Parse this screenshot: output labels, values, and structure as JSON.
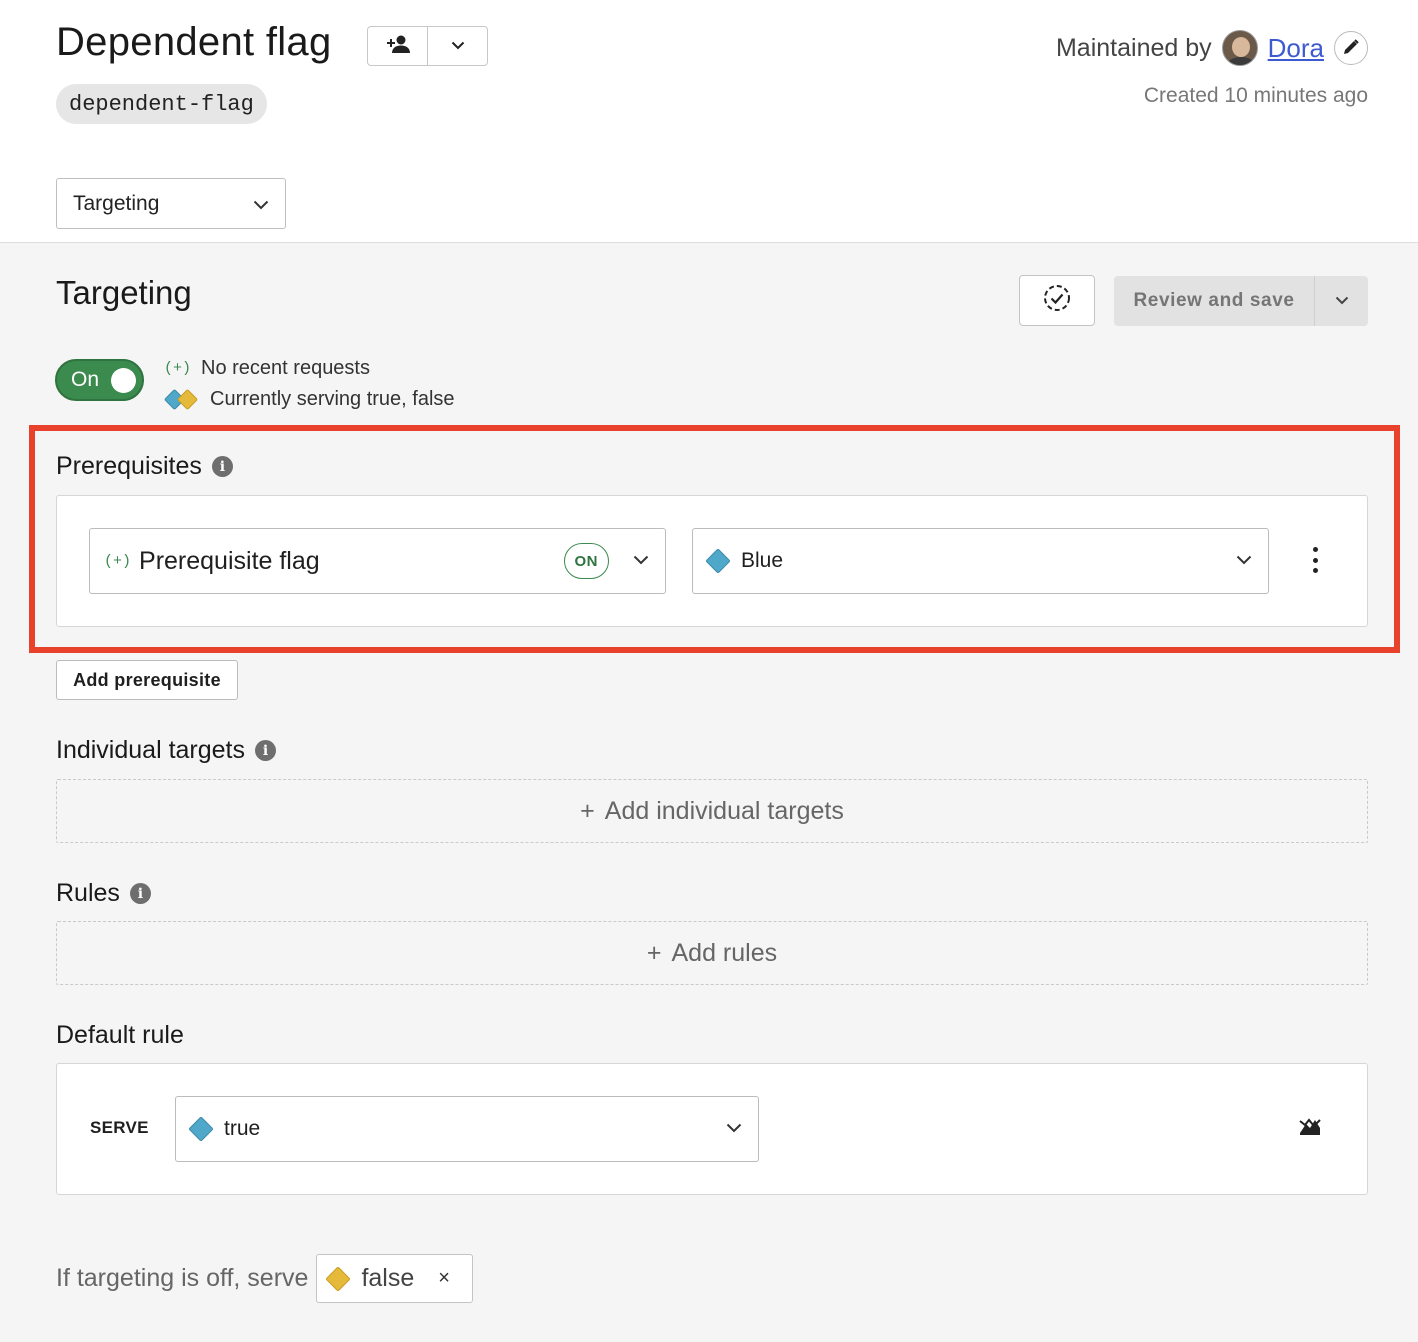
{
  "header": {
    "flag_name": "Dependent flag",
    "flag_key": "dependent-flag",
    "maintained_by_label": "Maintained by",
    "maintainer_name": "Dora",
    "created_text": "Created 10 minutes ago",
    "view_select_value": "Targeting"
  },
  "targeting": {
    "title": "Targeting",
    "review_save_label": "Review and save",
    "toggle_label": "On",
    "plus_mark": "(+)",
    "no_recent_requests": "No recent requests",
    "serving_text": "Currently serving true, false"
  },
  "prerequisites": {
    "title": "Prerequisites",
    "items": [
      {
        "flag_name": "Prerequisite flag",
        "flag_status": "ON",
        "variation": "Blue",
        "variation_color": "#4fa8c9"
      }
    ],
    "add_label": "Add prerequisite"
  },
  "individual_targets": {
    "title": "Individual targets",
    "add_label": "Add individual targets",
    "plus": "+"
  },
  "rules": {
    "title": "Rules",
    "add_label": "Add rules",
    "plus": "+"
  },
  "default_rule": {
    "title": "Default rule",
    "serve_label": "SERVE",
    "serve_value": "true",
    "serve_color": "#4fa8c9"
  },
  "off_variation": {
    "label": "If targeting is off, serve",
    "value": "false",
    "value_color": "#e5b93a",
    "clear_glyph": "×"
  },
  "colors": {
    "toggle_on": "#3b8a4e",
    "highlight_border": "#e8412c",
    "link": "#3d5ad1"
  }
}
